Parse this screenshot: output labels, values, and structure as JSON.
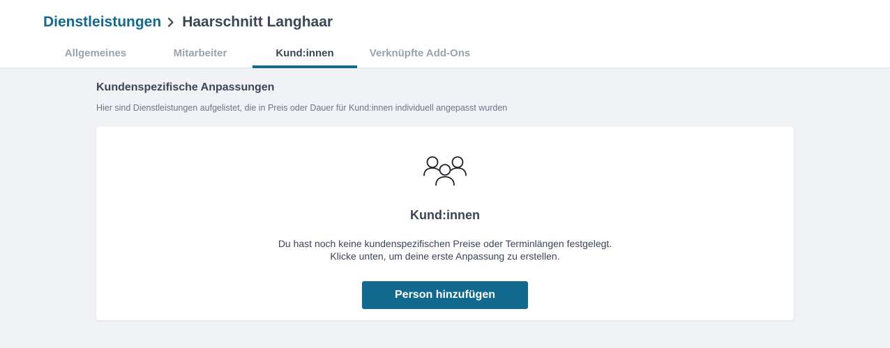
{
  "breadcrumb": {
    "parent": "Dienstleistungen",
    "current": "Haarschnitt Langhaar"
  },
  "tabs": [
    {
      "label": "Allgemeines",
      "active": false
    },
    {
      "label": "Mitarbeiter",
      "active": false
    },
    {
      "label": "Kund:innen",
      "active": true
    },
    {
      "label": "Verknüpfte Add-Ons",
      "active": false
    }
  ],
  "section": {
    "title": "Kundenspezifische Anpassungen",
    "description": "Hier sind Dienstleistungen aufgelistet, die in Preis oder Dauer für Kund:innen individuell angepasst wurden"
  },
  "empty_state": {
    "icon": "people-group-icon",
    "title": "Kund:innen",
    "text_line1": "Du hast noch keine kundenspezifischen Preise oder Terminlängen festgelegt.",
    "text_line2": "Klicke unten, um deine erste Anpassung zu erstellen.",
    "button_label": "Person hinzufügen"
  },
  "colors": {
    "accent": "#11698e",
    "text": "#3a4556",
    "muted": "#9aa2ad",
    "background": "#f1f2f5"
  }
}
